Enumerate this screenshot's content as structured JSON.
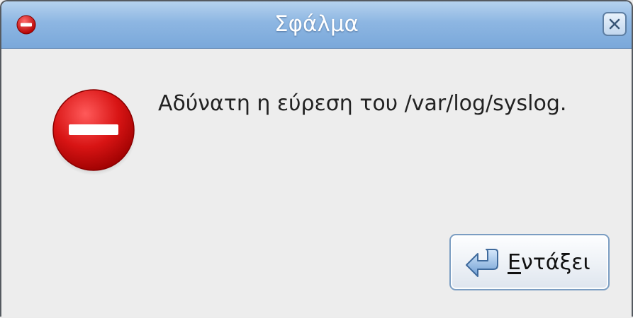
{
  "window": {
    "title": "Σφάλμα"
  },
  "dialog": {
    "message": "Αδύνατη η εύρεση του /var/log/syslog.",
    "icon": "error-icon"
  },
  "buttons": {
    "ok": {
      "mnemonic": "Ε",
      "rest": "ντάξει",
      "icon": "ok-arrow-icon"
    },
    "close_icon": "close-icon"
  },
  "colors": {
    "titlebar": "#8db6e2",
    "error_red": "#cc1111",
    "background": "#ededed"
  }
}
